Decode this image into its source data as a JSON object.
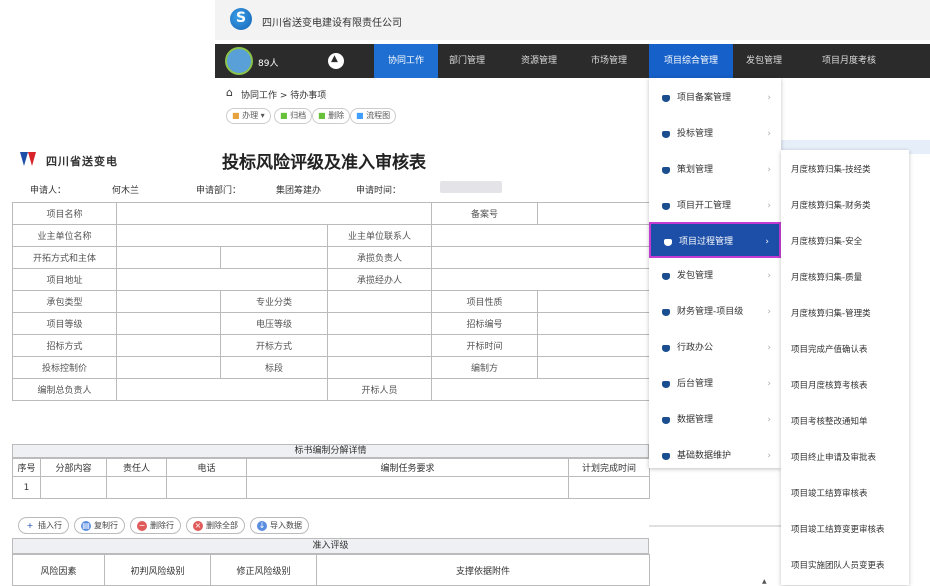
{
  "company": {
    "name": "四川省送变电建设有限责任公司"
  },
  "nav": {
    "user_count": "89人",
    "items": [
      "协同工作",
      "部门管理",
      "资源管理",
      "市场管理",
      "项目综合管理",
      "发包管理",
      "项目月度考核"
    ]
  },
  "breadcrumb": "协同工作 > 待办事项",
  "toolbar": [
    "办理 ▾",
    "归档",
    "删除",
    "流程图"
  ],
  "form": {
    "org_name": "四川省送变电",
    "title": "投标风险评级及准入审核表",
    "applicant_label": "申请人：",
    "applicant_value": "何木兰",
    "dept_label": "申请部门：",
    "dept_value": "集团筹建办",
    "time_label": "申请时间：",
    "labels": {
      "project_name": "项目名称",
      "record_no": "备案号",
      "owner_unit": "业主单位名称",
      "owner_contact": "业主单位联系人",
      "bid_method_subject": "开拓方式和主体",
      "undertake_lead": "承揽负责人",
      "project_address": "项目地址",
      "undertake_handler": "承揽经办人",
      "contract_type": "承包类型",
      "specialty": "专业分类",
      "project_nature": "项目性质",
      "project_level": "项目等级",
      "voltage_level": "电压等级",
      "bid_no": "招标编号",
      "bid_invite_method": "招标方式",
      "bid_open_method": "开标方式",
      "bid_open_time": "开标时间",
      "bid_control_price": "投标控制价",
      "bid_section": "标段",
      "compiler": "编制方",
      "compile_lead": "编制总负责人",
      "bid_open_person": "开标人员"
    },
    "section1_title": "标书编制分解详情",
    "sub_headers": [
      "序号",
      "分部内容",
      "责任人",
      "电话",
      "编制任务要求",
      "计划完成时间"
    ],
    "sub_row_no": "1",
    "row_buttons": [
      "插入行",
      "复制行",
      "删除行",
      "删除全部",
      "导入数据"
    ],
    "section2_title": "准入评级",
    "risk_headers": [
      "风险因素",
      "初判风险级别",
      "修正风险级别",
      "支撑依据附件"
    ]
  },
  "menu1": {
    "items": [
      "项目备案管理",
      "投标管理",
      "策划管理",
      "项目开工管理",
      "项目过程管理",
      "发包管理",
      "财务管理-项目级",
      "行政办公",
      "后台管理",
      "数据管理",
      "基础数据维护"
    ],
    "highlighted_index": 4
  },
  "menu2": {
    "items": [
      "月度核算归集-技经类",
      "月度核算归集-财务类",
      "月度核算归集-安全",
      "月度核算归集-质量",
      "月度核算归集-管理类",
      "项目完成产值确认表",
      "项目月度核算考核表",
      "项目考核整改通知单",
      "项目终止申请及审批表",
      "项目竣工结算审核表",
      "项目竣工结算变更审核表",
      "项目实施团队人员变更表"
    ]
  },
  "colors": {
    "nav_bg": "#2b2b2b",
    "active_blue": "#1560c9",
    "menu_highlight": "#1d4fa8",
    "highlight_border": "#c43bd1"
  }
}
